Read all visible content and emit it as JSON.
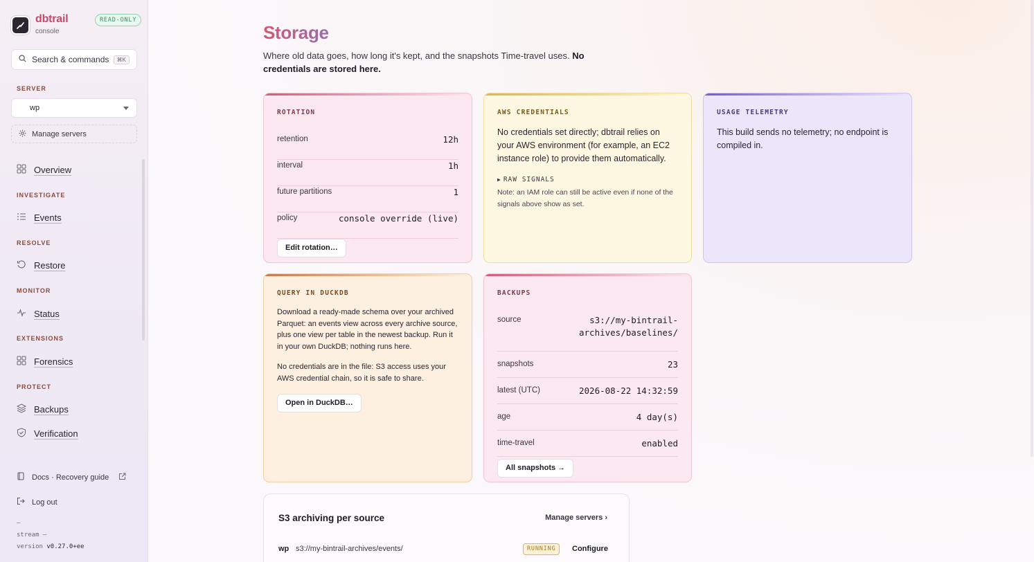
{
  "sidebar": {
    "brand_name": "dbtrail",
    "brand_sub": "console",
    "readonly_badge": "READ-ONLY",
    "search_label": "Search & commands",
    "search_kbd": "⌘K",
    "server_label": "SERVER",
    "server_selected": "wp",
    "manage_servers": "Manage servers",
    "overview": "Overview",
    "sections": {
      "investigate": "INVESTIGATE",
      "resolve": "RESOLVE",
      "monitor": "MONITOR",
      "extensions": "EXTENSIONS",
      "protect": "PROTECT"
    },
    "items": {
      "events": "Events",
      "restore": "Restore",
      "status": "Status",
      "forensics": "Forensics",
      "backups": "Backups",
      "verification": "Verification"
    },
    "docs_link": "Docs · Recovery guide",
    "logout": "Log out",
    "dash": "–",
    "stream": "stream —",
    "version_label": "version",
    "version": "v0.27.0+ee"
  },
  "page": {
    "title": "Storage",
    "desc": "Where old data goes, how long it's kept, and the snapshots Time-travel uses.",
    "desc_bold": "No credentials are stored here."
  },
  "rotation": {
    "label": "ROTATION",
    "rows": [
      {
        "k": "retention",
        "v": "12h"
      },
      {
        "k": "interval",
        "v": "1h"
      },
      {
        "k": "future partitions",
        "v": "1"
      },
      {
        "k": "policy",
        "v": "console override (live)"
      }
    ],
    "button": "Edit rotation…"
  },
  "aws": {
    "label": "AWS CREDENTIALS",
    "text": "No credentials set directly; dbtrail relies on your AWS environment (for example, an EC2 instance role) to provide them automatically.",
    "raw_signals": "RAW SIGNALS",
    "note": "Note: an IAM role can still be active even if none of the signals above show as set."
  },
  "telemetry": {
    "label": "USAGE TELEMETRY",
    "text": "This build sends no telemetry; no endpoint is compiled in."
  },
  "duckdb": {
    "label": "QUERY IN DUCKDB",
    "p1": "Download a ready-made schema over your archived Parquet: an events view across every archive source, plus one view per table in the newest backup. Run it in your own DuckDB; nothing runs here.",
    "p2": "No credentials are in the file: S3 access uses your AWS credential chain, so it is safe to share.",
    "button": "Open in DuckDB…"
  },
  "backups": {
    "label": "BACKUPS",
    "rows": [
      {
        "k": "source",
        "v": "s3://my-bintrail-archives/baselines/"
      },
      {
        "k": "snapshots",
        "v": "23"
      },
      {
        "k": "latest (UTC)",
        "v": "2026-08-22 14:32:59"
      },
      {
        "k": "age",
        "v": "4 day(s)"
      },
      {
        "k": "time-travel",
        "v": "enabled"
      }
    ],
    "button": "All snapshots →"
  },
  "s3": {
    "title": "S3 archiving per source",
    "manage": "Manage servers ›",
    "row": {
      "name": "wp",
      "path": "s3://my-bintrail-archives/events/",
      "status": "RUNNING",
      "action": "Configure"
    }
  },
  "colors": {
    "accent": "#c44a6a",
    "running": "#b07a1a"
  }
}
